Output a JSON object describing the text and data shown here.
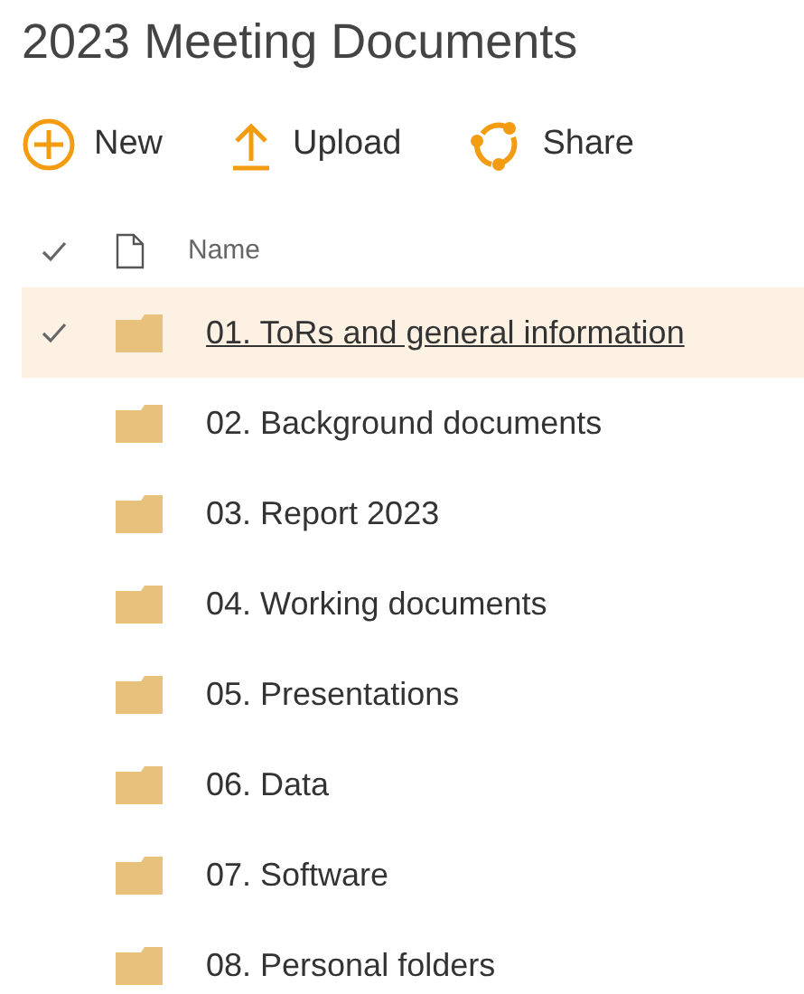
{
  "title": "2023 Meeting Documents",
  "toolbar": [
    {
      "kind": "new",
      "label": "New"
    },
    {
      "kind": "upload",
      "label": "Upload"
    },
    {
      "kind": "share",
      "label": "Share"
    }
  ],
  "table": {
    "columns": [
      {
        "label": "Name"
      }
    ],
    "rows": [
      {
        "name": "01. ToRs and general information",
        "selected": true
      },
      {
        "name": "02. Background documents",
        "selected": false
      },
      {
        "name": "03. Report 2023",
        "selected": false
      },
      {
        "name": "04. Working documents",
        "selected": false
      },
      {
        "name": "05. Presentations",
        "selected": false
      },
      {
        "name": "06. Data",
        "selected": false
      },
      {
        "name": "07. Software",
        "selected": false
      },
      {
        "name": "08. Personal folders",
        "selected": false
      }
    ]
  }
}
